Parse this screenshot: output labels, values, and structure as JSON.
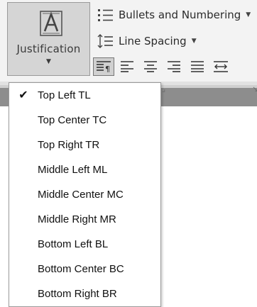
{
  "ribbon": {
    "justification": {
      "label": "Justification",
      "icon": "justification-A-icon"
    },
    "bullets_label": "Bullets and Numbering",
    "line_spacing_label": "Line Spacing",
    "alignment_buttons": [
      {
        "name": "default-align-icon",
        "active": true
      },
      {
        "name": "align-left-icon",
        "active": false
      },
      {
        "name": "align-center-icon",
        "active": false
      },
      {
        "name": "align-right-icon",
        "active": false
      },
      {
        "name": "justify-icon",
        "active": false
      },
      {
        "name": "distribute-icon",
        "active": false
      }
    ]
  },
  "menu": {
    "items": [
      {
        "label": "Top Left TL",
        "checked": true
      },
      {
        "label": "Top Center TC",
        "checked": false
      },
      {
        "label": "Top Right TR",
        "checked": false
      },
      {
        "label": "Middle Left ML",
        "checked": false
      },
      {
        "label": "Middle Center MC",
        "checked": false
      },
      {
        "label": "Middle Right MR",
        "checked": false
      },
      {
        "label": "Bottom Left BL",
        "checked": false
      },
      {
        "label": "Bottom Center BC",
        "checked": false
      },
      {
        "label": "Bottom Right BR",
        "checked": false
      }
    ],
    "check_glyph": "✔"
  }
}
